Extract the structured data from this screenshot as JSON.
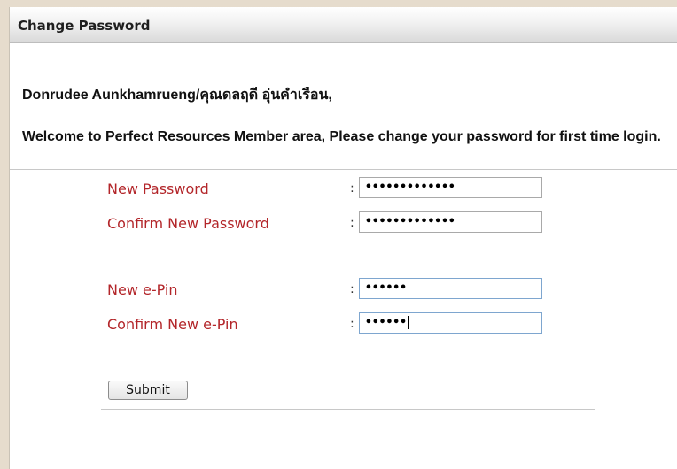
{
  "header": {
    "title": "Change Password"
  },
  "greeting": "Donrudee Aunkhamrueng/คุณดลฤดี อุ่นคำเรือน,",
  "welcome": "Welcome to Perfect Resources Member area, Please change your password for first time login.",
  "form": {
    "separator": ":",
    "new_password": {
      "label": "New Password",
      "value": "•••••••••••••"
    },
    "confirm_password": {
      "label": "Confirm New Password",
      "value": "•••••••••••••"
    },
    "new_epin": {
      "label": "New e-Pin",
      "value": "••••••"
    },
    "confirm_epin": {
      "label": "Confirm New e-Pin",
      "value": "••••••"
    },
    "submit_label": "Submit"
  },
  "colors": {
    "label": "#b3262a",
    "background": "#e6dccd",
    "focus_border": "#7ea6cf"
  }
}
